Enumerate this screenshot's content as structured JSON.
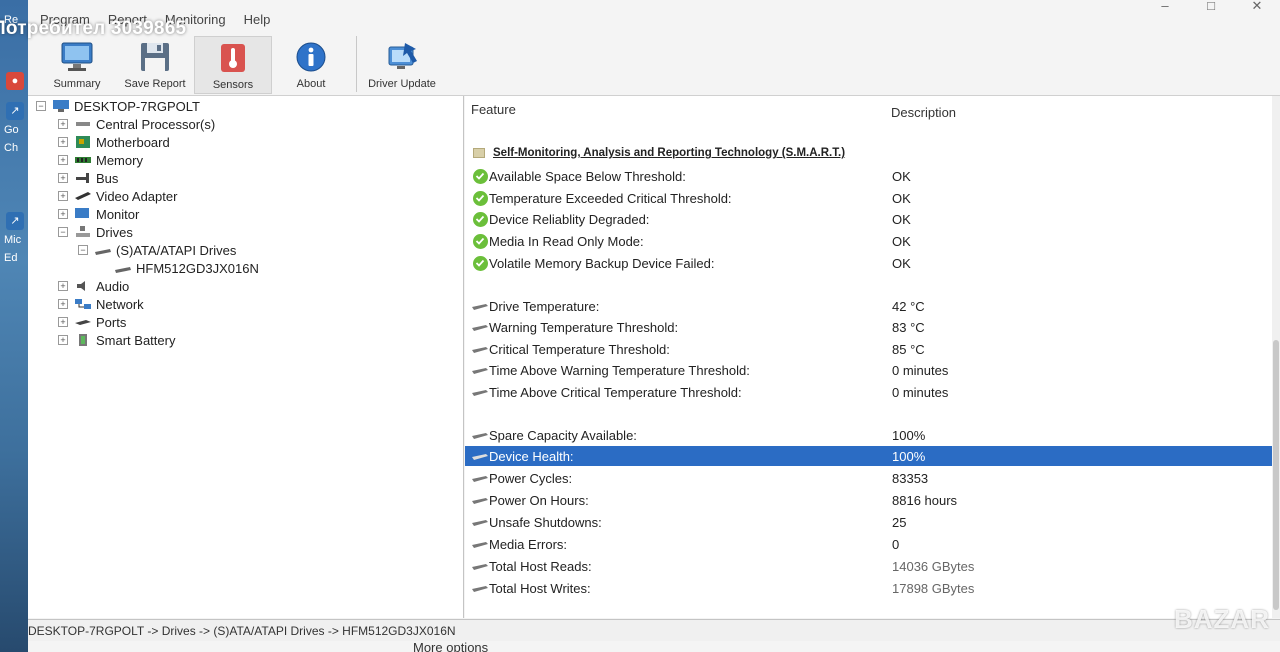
{
  "watermark": "Потребител 3039865",
  "brand": "BAZAR",
  "desktop": {
    "labels": [
      "Re",
      "Go",
      "Ch",
      "Mic",
      "Ed"
    ]
  },
  "menu": [
    "Program",
    "Report",
    "Monitoring",
    "Help"
  ],
  "window_controls": [
    "–",
    "□",
    "✕"
  ],
  "toolbar": {
    "summary": "Summary",
    "save_report": "Save Report",
    "sensors": "Sensors",
    "about": "About",
    "driver_update": "Driver Update"
  },
  "tree": {
    "root": "DESKTOP-7RGPOLT",
    "items": [
      {
        "label": "Central Processor(s)",
        "icon": "cpu-icon"
      },
      {
        "label": "Motherboard",
        "icon": "motherboard-icon"
      },
      {
        "label": "Memory",
        "icon": "memory-icon"
      },
      {
        "label": "Bus",
        "icon": "bus-icon"
      },
      {
        "label": "Video Adapter",
        "icon": "video-adapter-icon"
      },
      {
        "label": "Monitor",
        "icon": "monitor-icon"
      },
      {
        "label": "Drives",
        "icon": "drives-icon"
      },
      {
        "label": "(S)ATA/ATAPI Drives",
        "icon": "drive-icon"
      },
      {
        "label": "HFM512GD3JX016N",
        "icon": "drive-icon"
      },
      {
        "label": "Audio",
        "icon": "audio-icon"
      },
      {
        "label": "Network",
        "icon": "network-icon"
      },
      {
        "label": "Ports",
        "icon": "ports-icon"
      },
      {
        "label": "Smart Battery",
        "icon": "battery-icon"
      }
    ]
  },
  "details": {
    "header_feature": "Feature",
    "header_description": "Description",
    "section_title": "Self-Monitoring, Analysis and Reporting Technology (S.M.A.R.T.)",
    "rows": [
      {
        "feature": "Available Space Below Threshold:",
        "value": "OK"
      },
      {
        "feature": "Temperature Exceeded Critical Threshold:",
        "value": "OK"
      },
      {
        "feature": "Device Reliablity Degraded:",
        "value": "OK"
      },
      {
        "feature": "Media In Read Only Mode:",
        "value": "OK"
      },
      {
        "feature": "Volatile Memory Backup Device Failed:",
        "value": "OK"
      },
      {
        "feature": "Drive Temperature:",
        "value": "42 °C"
      },
      {
        "feature": "Warning Temperature Threshold:",
        "value": "83 °C"
      },
      {
        "feature": "Critical Temperature Threshold:",
        "value": "85 °C"
      },
      {
        "feature": "Time Above Warning Temperature Threshold:",
        "value": "0 minutes"
      },
      {
        "feature": "Time Above Critical Temperature Threshold:",
        "value": "0 minutes"
      },
      {
        "feature": "Spare Capacity Available:",
        "value": "100%"
      },
      {
        "feature": "Device Health:",
        "value": "100%"
      },
      {
        "feature": "Power Cycles:",
        "value": "83353"
      },
      {
        "feature": "Power On Hours:",
        "value": "8816 hours"
      },
      {
        "feature": "Unsafe Shutdowns:",
        "value": "25"
      },
      {
        "feature": "Media Errors:",
        "value": "0"
      },
      {
        "feature": "Total Host Reads:",
        "value": "14036 GBytes"
      },
      {
        "feature": "Total Host Writes:",
        "value": "17898 GBytes"
      }
    ]
  },
  "statusbar": "DESKTOP-7RGPOLT -> Drives -> (S)ATA/ATAPI Drives -> HFM512GD3JX016N",
  "below_text": "More options",
  "colors": {
    "selection": "#2b6cc4",
    "ok_check": "#6bbf3a"
  }
}
